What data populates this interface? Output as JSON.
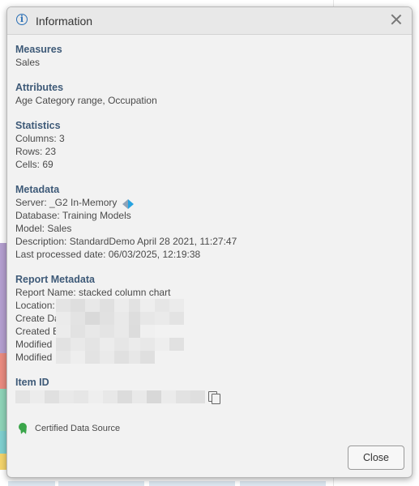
{
  "dialog": {
    "title": "Information",
    "close_button_label": "Close"
  },
  "measures": {
    "title": "Measures",
    "value": "Sales"
  },
  "attributes": {
    "title": "Attributes",
    "value": "Age Category range, Occupation"
  },
  "statistics": {
    "title": "Statistics",
    "columns": "Columns: 3",
    "rows": "Rows: 23",
    "cells": "Cells: 69"
  },
  "metadata": {
    "title": "Metadata",
    "server": "Server: _G2 In-Memory",
    "database": "Database: Training Models",
    "model": "Model: Sales",
    "description": "Description: StandardDemo April 28 2021, 11:27:47",
    "last_processed": "Last processed date: 06/03/2025, 12:19:38"
  },
  "report_metadata": {
    "title": "Report Metadata",
    "report_name": "Report Name: stacked column chart",
    "location": "Location:",
    "create_date": "Create Da",
    "created_by": "Created B",
    "modified_1": "Modified",
    "modified_2": "Modified"
  },
  "item_id": {
    "title": "Item ID"
  },
  "certified": {
    "label": "Certified Data Source"
  },
  "icons": {
    "info": "info-icon",
    "close": "close-icon",
    "server": "server-icon",
    "copy": "copy-icon",
    "certified": "certified-badge-icon"
  },
  "colors": {
    "section_title": "#3e5a78",
    "info_icon": "#2a6fb5",
    "certified": "#3aa54a",
    "dialog_bg": "#f2f2f2"
  }
}
